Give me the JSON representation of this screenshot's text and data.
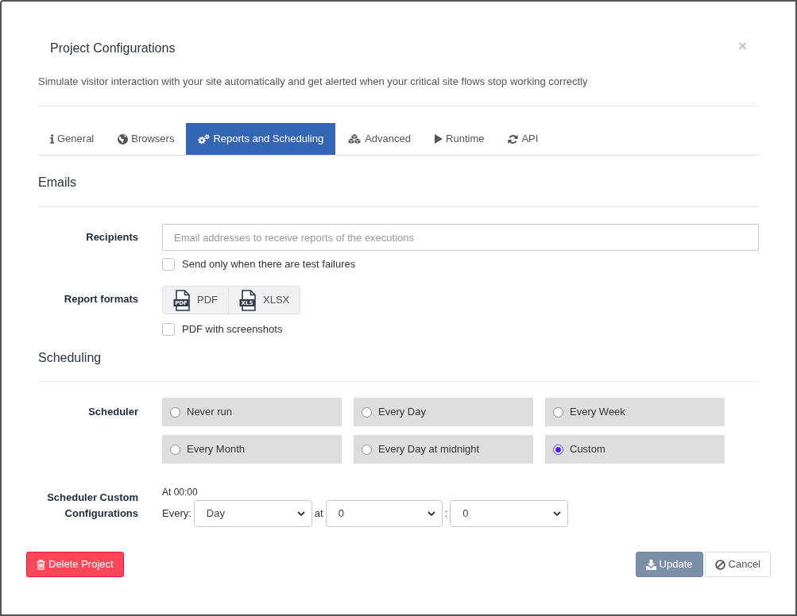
{
  "dialog": {
    "title": "Project Configurations",
    "close": "×",
    "subtitle": "Simulate visitor interaction with your site automatically and get alerted when your critical site flows stop working correctly"
  },
  "tabs": [
    {
      "label": "General",
      "selected": false
    },
    {
      "label": "Browsers",
      "selected": false
    },
    {
      "label": "Reports and Scheduling",
      "selected": true
    },
    {
      "label": "Advanced",
      "selected": false
    },
    {
      "label": "Runtime",
      "selected": false
    },
    {
      "label": "API",
      "selected": false
    }
  ],
  "emails": {
    "heading": "Emails",
    "recipients": {
      "label": "Recipients",
      "placeholder": "Email addresses to receive reports of the executions"
    },
    "failures_only": {
      "label": "Send only when there are test failures",
      "checked": false
    },
    "report_formats": {
      "label": "Report formats",
      "options": [
        {
          "label": "PDF",
          "icon_text": "PDF"
        },
        {
          "label": "XLSX",
          "icon_text": "XLS"
        }
      ]
    },
    "pdf_screenshots": {
      "label": "PDF with screenshots",
      "checked": false
    }
  },
  "scheduling": {
    "heading": "Scheduling",
    "scheduler": {
      "label": "Scheduler",
      "options": [
        {
          "label": "Never run",
          "selected": false
        },
        {
          "label": "Every Day",
          "selected": false
        },
        {
          "label": "Every Week",
          "selected": false
        },
        {
          "label": "Every Month",
          "selected": false
        },
        {
          "label": "Every Day at midnight",
          "selected": false
        },
        {
          "label": "Custom",
          "selected": true
        }
      ]
    },
    "custom": {
      "label": "Scheduler Custom Configurations",
      "summary": "At 00:00",
      "every_label": "Every:",
      "unit": "Day",
      "at_label": "at",
      "hour": "0",
      "separator": ":",
      "minute": "0"
    }
  },
  "footer": {
    "delete": "Delete Project",
    "update": "Update",
    "cancel": "Cancel"
  }
}
